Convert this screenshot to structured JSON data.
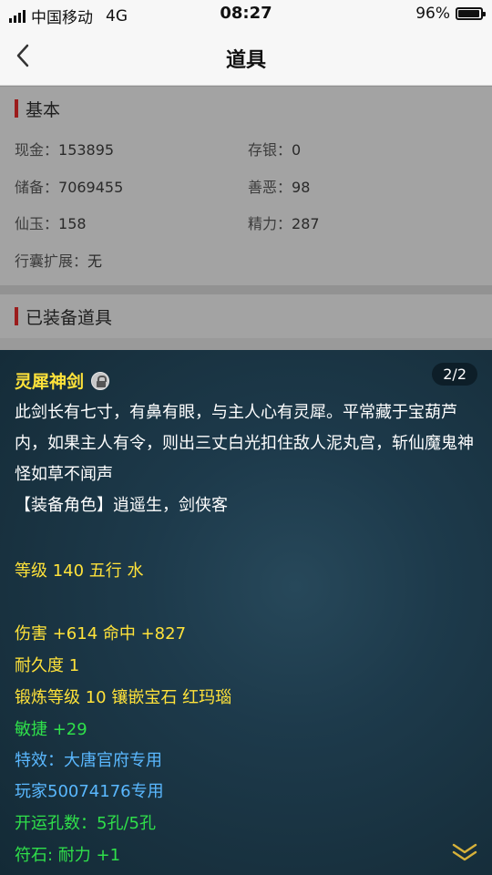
{
  "status_bar": {
    "carrier": "中国移动",
    "network": "4G",
    "time": "08:27",
    "battery": "96%",
    "battery_level": 0.96
  },
  "nav": {
    "title": "道具",
    "back_icon": "chevron-left-icon"
  },
  "basic": {
    "title": "基本",
    "stats": {
      "cash": {
        "label": "现金：",
        "value": "153895"
      },
      "savings": {
        "label": "存银：",
        "value": "0"
      },
      "reserve": {
        "label": "储备：",
        "value": "7069455"
      },
      "karma": {
        "label": "善恶：",
        "value": "98"
      },
      "jade": {
        "label": "仙玉：",
        "value": "158"
      },
      "energy": {
        "label": "精力：",
        "value": "287"
      },
      "bag_expand": {
        "label": "行囊扩展：",
        "value": "无"
      }
    }
  },
  "equipped": {
    "title": "已装备道具"
  },
  "item_detail": {
    "page_indicator": "2/2",
    "name": "灵犀神剑",
    "lock_icon": "lock-coin-icon",
    "description": "此剑长有七寸，有鼻有眼，与主人心有灵犀。平常藏于宝葫芦内，如果主人有令，则出三丈白光扣住敌人泥丸宫，斩仙魔鬼神怪如草不闻声",
    "role_line": "【装备角色】逍遥生，剑侠客",
    "level_line": "等级 140 五行 水",
    "damage_line": "伤害 +614 命中 +827",
    "durability_line": "耐久度 1",
    "forge_line": "锻炼等级 10 镶嵌宝石 红玛瑙",
    "agility_line": "敏捷 +29",
    "effect_line": "特效：大唐官府专用",
    "player_line": "玩家50074176专用",
    "holes_line": "开运孔数：5孔/5孔",
    "rune_line": "符石: 耐力 +1",
    "expand_icon": "double-chevron-down-icon",
    "colors": {
      "yellow": "#ffe23a",
      "green": "#2fe04a",
      "blue": "#5ab8ff",
      "white": "#ffffff"
    }
  }
}
